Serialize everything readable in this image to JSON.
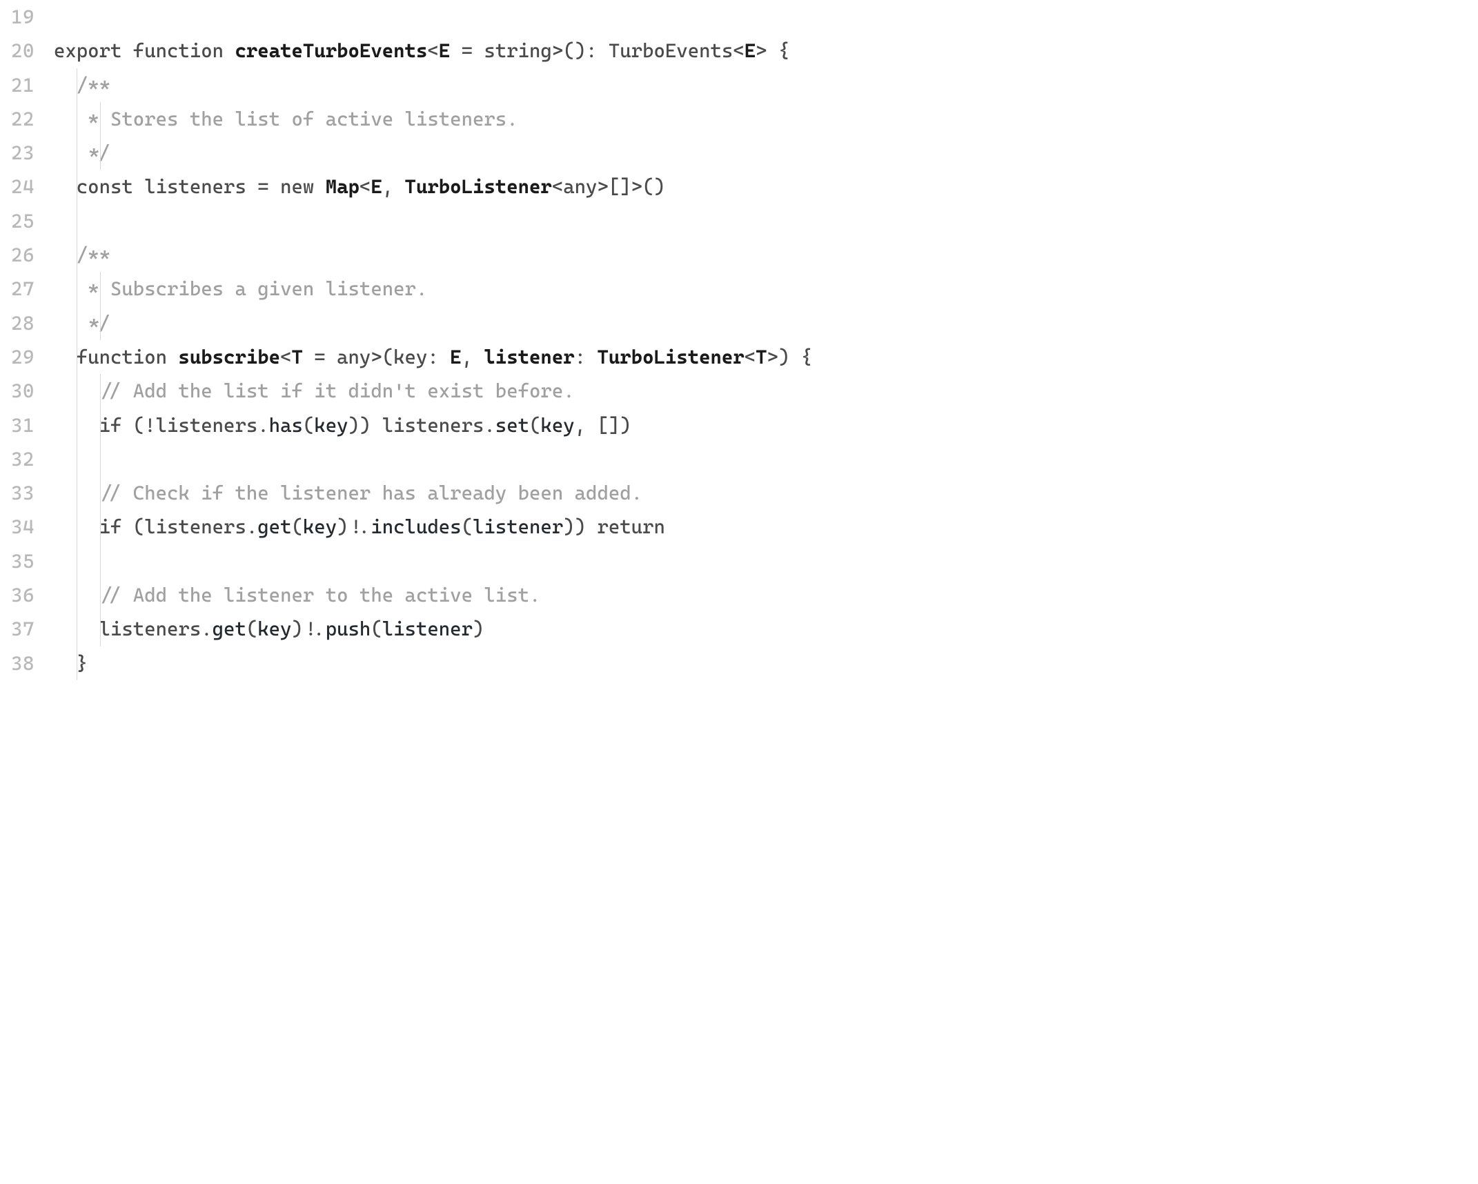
{
  "lineNumbers": [
    "19",
    "20",
    "21",
    "22",
    "23",
    "24",
    "25",
    "26",
    "27",
    "28",
    "29",
    "30",
    "31",
    "32",
    "33",
    "34",
    "35",
    "36",
    "37",
    "38"
  ],
  "code": {
    "l20": {
      "kw_export": "export",
      "kw_function": "function",
      "fn_name": "createTurboEvents",
      "lt": "<",
      "tp_E": "E",
      "eq_str": " = string>(): ",
      "ret_type": "TurboEvents",
      "lt2": "<",
      "tp_E2": "E",
      "tail": "> {"
    },
    "l21": {
      "text": "/**"
    },
    "l22": {
      "text": " * Stores the list of active listeners."
    },
    "l23": {
      "text": " */"
    },
    "l24": {
      "pre": "const listeners = new ",
      "Map": "Map",
      "lt": "<",
      "E": "E",
      "comma": ", ",
      "TL": "TurboListener",
      "tail": "<any>[]>()"
    },
    "l26": {
      "text": "/**"
    },
    "l27": {
      "text": " * Subscribes a given listener."
    },
    "l28": {
      "text": " */"
    },
    "l29": {
      "kw_function": "function ",
      "fn_name": "subscribe",
      "lt": "<",
      "T": "T",
      "eq_any": " = any>(",
      "key": "key",
      "colon1": ": ",
      "E": "E",
      "comma": ", ",
      "listener": "listener",
      "colon2": ": ",
      "TL": "TurboListener",
      "lt2": "<",
      "T2": "T",
      "tail": ">) {"
    },
    "l30": {
      "text": "// Add the list if it didn't exist before."
    },
    "l31": {
      "p1": "if (!listeners.",
      "has": "has",
      "p2": "(",
      "key1": "key",
      "p3": ")) listeners.",
      "set": "set",
      "p4": "(",
      "key2": "key",
      "p5": ", [])"
    },
    "l33": {
      "text": "// Check if the listener has already been added."
    },
    "l34": {
      "p1": "if (listeners.",
      "get": "get",
      "p2": "(",
      "key": "key",
      "p3": ")!.",
      "includes": "includes",
      "p4": "(",
      "listener": "listener",
      "p5": ")) return"
    },
    "l36": {
      "text": "// Add the listener to the active list."
    },
    "l37": {
      "p1": "listeners.",
      "get": "get",
      "p2": "(",
      "key": "key",
      "p3": ")!.",
      "push": "push",
      "p4": "(",
      "listener": "listener",
      "p5": ")"
    },
    "l38": {
      "text": "}"
    }
  }
}
